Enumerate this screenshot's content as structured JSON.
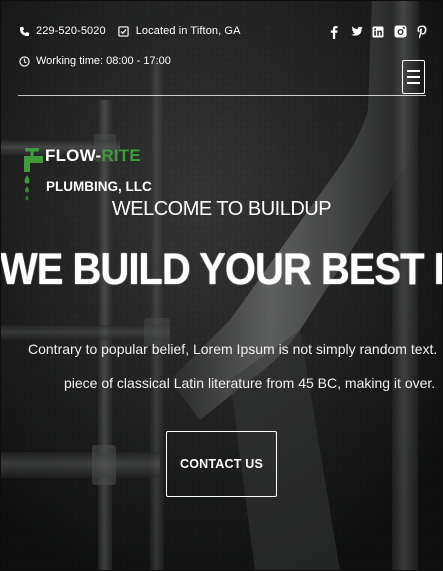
{
  "topbar": {
    "phone": "229-520-5020",
    "location": "Located in Tifton, GA",
    "hours": "Working time: 08:00 - 17:00",
    "social": [
      "facebook-icon",
      "twitter-icon",
      "linkedin-icon",
      "instagram-icon",
      "pinterest-icon"
    ]
  },
  "logo": {
    "word1": "FLOW-",
    "word1_accent": "RITE",
    "word2": "PLUMBING, LLC",
    "accent_color": "#3f9a3a"
  },
  "hero": {
    "welcome": "WELCOME TO BUILDUP",
    "title": "WE BUILD YOUR BEST LIFE",
    "desc_line1": "Contrary to popular belief, Lorem Ipsum is not simply random text. It has roots in",
    "desc_line2": "piece of classical Latin literature from 45 BC, making it over.",
    "cta_label": "CONTACT US"
  },
  "menu": {
    "icon": "hamburger-menu-icon"
  }
}
